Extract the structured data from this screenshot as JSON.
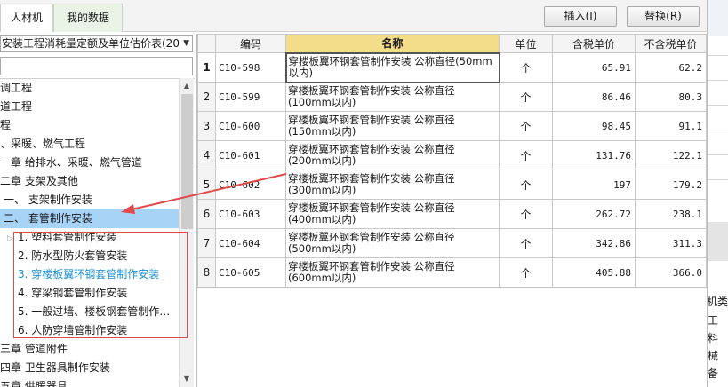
{
  "tabs": [
    {
      "label": "人材机"
    },
    {
      "label": "我的数据"
    }
  ],
  "toolbar": {
    "insert_label": "插入(I)",
    "replace_label": "替换(R)"
  },
  "left": {
    "library": "安装工程消耗量定额及单位估价表(20",
    "tree": [
      {
        "label": "调工程"
      },
      {
        "label": "道工程"
      },
      {
        "label": "程"
      },
      {
        "label": "、采暖、燃气工程"
      },
      {
        "label": "一章 给排水、采暖、燃气管道"
      },
      {
        "label": "二章 支架及其他"
      },
      {
        "label": "一、 支架制作安装"
      },
      {
        "label": "二、 套管制作安装"
      },
      {
        "label": "1. 塑料套管制作安装"
      },
      {
        "label": "2. 防水型防火套管安装"
      },
      {
        "label": "3. 穿楼板翼环钢套管制作安装"
      },
      {
        "label": "4. 穿梁钢套管制作安装"
      },
      {
        "label": "5. 一般过墙、楼板钢套管制作…"
      },
      {
        "label": "6. 人防穿墙管制作安装"
      },
      {
        "label": "三章 管道附件"
      },
      {
        "label": "四章 卫生器具制作安装"
      },
      {
        "label": "五章 供暖器具"
      }
    ]
  },
  "table": {
    "headers": [
      "",
      "编码",
      "名称",
      "单位",
      "含税单价",
      "不含税单价"
    ],
    "rows": [
      {
        "n": "1",
        "code": "C10-598",
        "name": "穿楼板翼环钢套管制作安装 公称直径(50mm以内)",
        "unit": "个",
        "p1": "65.91",
        "p2": "62.2"
      },
      {
        "n": "2",
        "code": "C10-599",
        "name": "穿楼板翼环钢套管制作安装 公称直径(100mm以内)",
        "unit": "个",
        "p1": "86.46",
        "p2": "80.3"
      },
      {
        "n": "3",
        "code": "C10-600",
        "name": "穿楼板翼环钢套管制作安装 公称直径(150mm以内)",
        "unit": "个",
        "p1": "98.45",
        "p2": "91.1"
      },
      {
        "n": "4",
        "code": "C10-601",
        "name": "穿楼板翼环钢套管制作安装 公称直径(200mm以内)",
        "unit": "个",
        "p1": "131.76",
        "p2": "122.1"
      },
      {
        "n": "5",
        "code": "C10-602",
        "name": "穿楼板翼环钢套管制作安装 公称直径(300mm以内)",
        "unit": "个",
        "p1": "197",
        "p2": "179.2"
      },
      {
        "n": "6",
        "code": "C10-603",
        "name": "穿楼板翼环钢套管制作安装 公称直径(400mm以内)",
        "unit": "个",
        "p1": "262.72",
        "p2": "238.1"
      },
      {
        "n": "7",
        "code": "C10-604",
        "name": "穿楼板翼环钢套管制作安装 公称直径(500mm以内)",
        "unit": "个",
        "p1": "342.86",
        "p2": "311.3"
      },
      {
        "n": "8",
        "code": "C10-605",
        "name": "穿楼板翼环钢套管制作安装 公称直径(600mm以内)",
        "unit": "个",
        "p1": "405.88",
        "p2": "366.0"
      }
    ]
  },
  "right_panel": {
    "header": "机类别",
    "items": [
      "工",
      "料",
      "械",
      "备"
    ]
  },
  "colors": {
    "selection": "#a7d3f7",
    "header_highlight": "#f3dc8a",
    "annotation": "#e04a4a",
    "current_item": "#1a8fcf"
  }
}
